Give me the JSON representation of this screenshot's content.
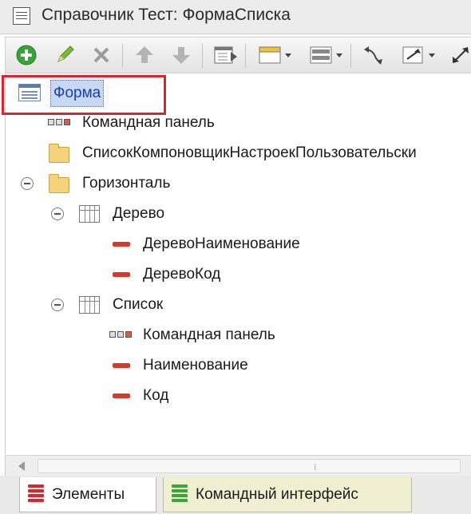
{
  "window": {
    "title": "Справочник Тест: ФормаСписка"
  },
  "toolbar": {
    "buttons": [
      {
        "icon": "add-circle-icon"
      },
      {
        "icon": "pencil-icon"
      },
      {
        "icon": "delete-x-icon"
      },
      {
        "icon": "move-up-icon"
      },
      {
        "icon": "move-down-icon"
      },
      {
        "icon": "form-properties-icon"
      },
      {
        "icon": "panel-dropdown-icon"
      },
      {
        "icon": "layout-dropdown-icon"
      },
      {
        "icon": "swap-arrows-icon"
      },
      {
        "icon": "resize-dropdown-icon"
      },
      {
        "icon": "expand-icon"
      }
    ]
  },
  "tree": {
    "root": {
      "label": "Форма",
      "selected": true
    },
    "items": [
      {
        "label": "Командная панель",
        "type": "command-bar"
      },
      {
        "label": "СписокКомпоновщикНастроекПользовательски",
        "type": "folder"
      },
      {
        "label": "Горизонталь",
        "type": "folder",
        "expanded": true
      },
      {
        "label": "Дерево",
        "type": "table",
        "expanded": true
      },
      {
        "label": "ДеревоНаименование",
        "type": "field"
      },
      {
        "label": "ДеревоКод",
        "type": "field"
      },
      {
        "label": "Список",
        "type": "table",
        "expanded": true
      },
      {
        "label": "Командная панель",
        "type": "command-bar"
      },
      {
        "label": "Наименование",
        "type": "field"
      },
      {
        "label": "Код",
        "type": "field"
      }
    ]
  },
  "tabs": [
    {
      "label": "Элементы",
      "active": true,
      "color": "#d9262f"
    },
    {
      "label": "Командный интерфейс",
      "active": false,
      "color": "#3aa63a"
    }
  ],
  "colors": {
    "highlight": "#d9262f",
    "selection": "#c6d8f3"
  }
}
